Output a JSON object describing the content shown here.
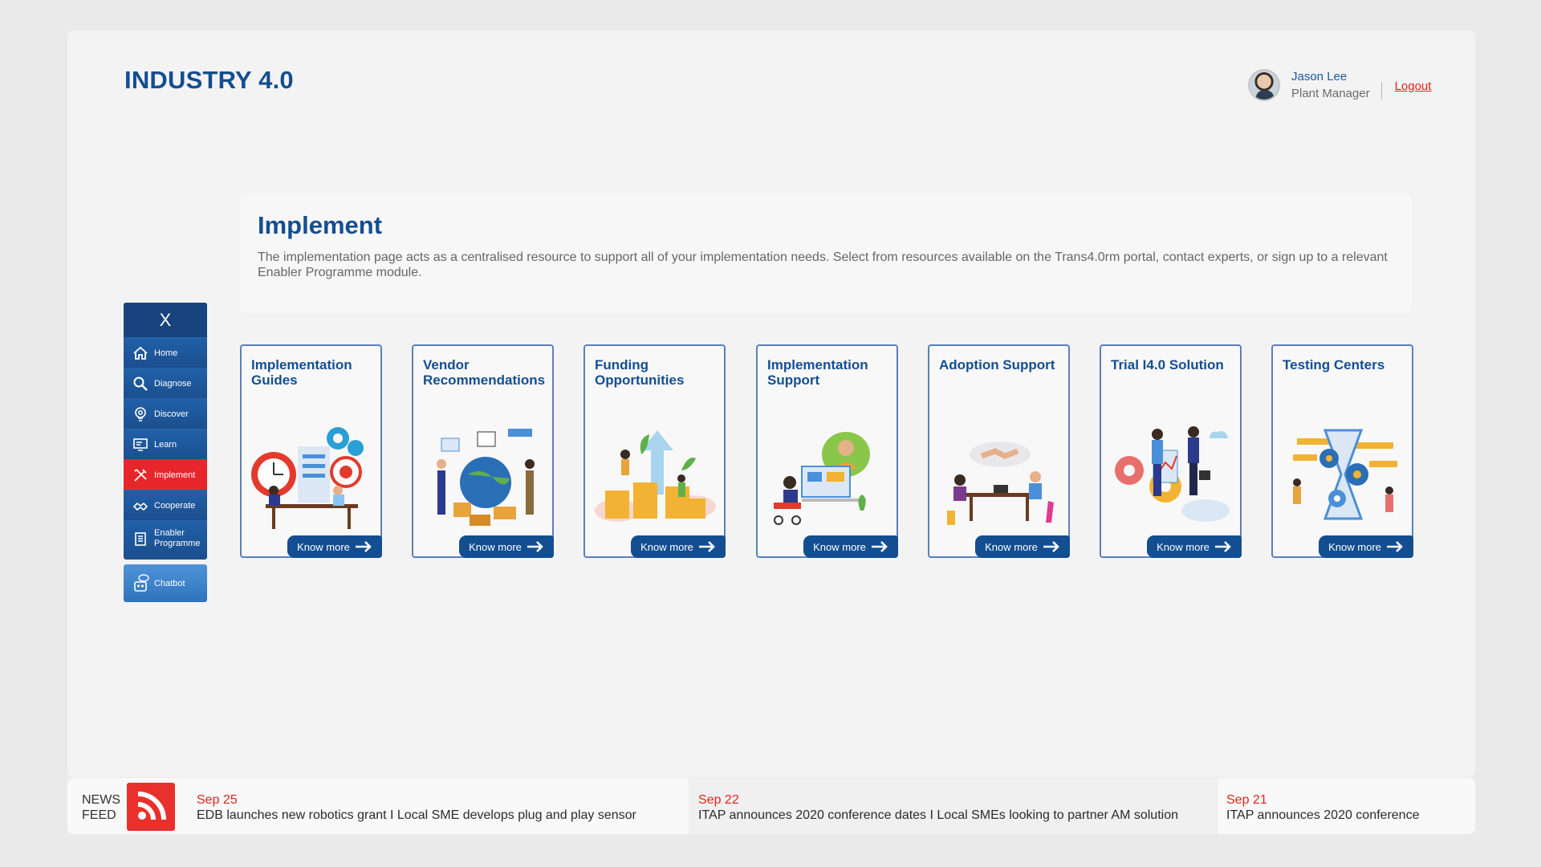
{
  "brand": "INDUSTRY 4.0",
  "user": {
    "name": "Jason Lee",
    "role": "Plant Manager",
    "logout": "Logout"
  },
  "intro": {
    "title": "Implement",
    "description": "The implementation page acts as a centralised resource to support all of your implementation needs. Select from resources available on the Trans4.0rm portal, contact experts, or sign up to a relevant Enabler Programme module."
  },
  "sidebar": {
    "close": "X",
    "items": [
      {
        "label": "Home",
        "icon": "home-icon"
      },
      {
        "label": "Diagnose",
        "icon": "search-icon"
      },
      {
        "label": "Discover",
        "icon": "lightbulb-gear-icon"
      },
      {
        "label": "Learn",
        "icon": "monitor-icon"
      },
      {
        "label": "Implement",
        "icon": "tools-icon",
        "active": true
      },
      {
        "label": "Cooperate",
        "icon": "cooperate-icon"
      },
      {
        "label": "Enabler Programme",
        "icon": "building-icon"
      }
    ],
    "chatbot": "Chatbot"
  },
  "cards": [
    {
      "title": "Implementation Guides",
      "button": "Know more"
    },
    {
      "title": "Vendor Recommendations",
      "button": "Know more"
    },
    {
      "title": "Funding Opportunities",
      "button": "Know more"
    },
    {
      "title": "Implementation Support",
      "button": "Know more"
    },
    {
      "title": "Adoption Support",
      "button": "Know more"
    },
    {
      "title": "Trial I4.0 Solution",
      "button": "Know more"
    },
    {
      "title": "Testing Centers",
      "button": "Know more"
    }
  ],
  "news": {
    "label_line1": "NEWS",
    "label_line2": "FEED",
    "items": [
      {
        "date": "Sep 25",
        "text": "EDB launches new robotics grant  I   Local SME develops plug and play sensor"
      },
      {
        "date": "Sep 22",
        "text": "ITAP announces 2020 conference dates   I   Local SMEs looking to partner AM solution"
      },
      {
        "date": "Sep 21",
        "text": "ITAP announces 2020 conference"
      }
    ]
  },
  "colors": {
    "primary": "#134e91",
    "accent": "#e7262c",
    "card_border": "#5b7fbe"
  }
}
